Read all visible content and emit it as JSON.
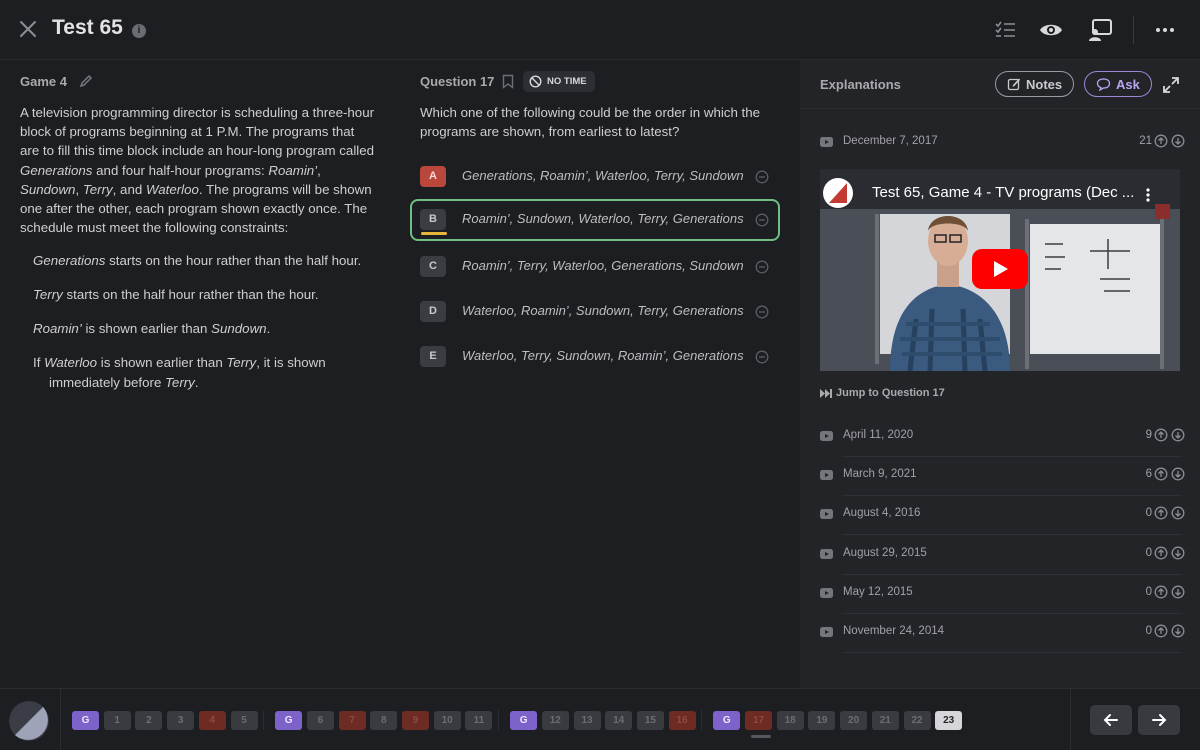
{
  "header": {
    "title": "Test 65",
    "info_glyph": "i",
    "icons": [
      "close-icon",
      "info-icon",
      "checklist-icon",
      "eye-icon",
      "present-icon",
      "more-icon"
    ]
  },
  "stimulus": {
    "game_label": "Game 4",
    "intro": [
      {
        "t": "A television programming director is scheduling a three-hour block of programs beginning at 1 P.M. The programs that are to fill this time block include an hour-long program called ",
        "i": false
      },
      {
        "t": "Generations",
        "i": true
      },
      {
        "t": " and four half-hour programs: ",
        "i": false
      },
      {
        "t": "Roamin’",
        "i": true
      },
      {
        "t": ", ",
        "i": false
      },
      {
        "t": "Sundown",
        "i": true
      },
      {
        "t": ", ",
        "i": false
      },
      {
        "t": "Terry",
        "i": true
      },
      {
        "t": ", and ",
        "i": false
      },
      {
        "t": "Waterloo",
        "i": true
      },
      {
        "t": ". The programs will be shown one after the other, each program shown exactly once. The schedule must meet the following constraints:",
        "i": false
      }
    ],
    "rules": [
      [
        {
          "t": "Generations",
          "i": true
        },
        {
          "t": " starts on the hour rather than the half hour.",
          "i": false
        }
      ],
      [
        {
          "t": "Terry",
          "i": true
        },
        {
          "t": " starts on the half hour rather than the hour.",
          "i": false
        }
      ],
      [
        {
          "t": "Roamin’",
          "i": true
        },
        {
          "t": " is shown earlier than ",
          "i": false
        },
        {
          "t": "Sundown",
          "i": true
        },
        {
          "t": ".",
          "i": false
        }
      ],
      [
        {
          "t": "If ",
          "i": false
        },
        {
          "t": "Waterloo",
          "i": true
        },
        {
          "t": " is shown earlier than ",
          "i": false
        },
        {
          "t": "Terry",
          "i": true
        },
        {
          "t": ", it is shown",
          "i": false
        }
      ]
    ],
    "rule4_cont": [
      {
        "t": "immediately before ",
        "i": false
      },
      {
        "t": "Terry",
        "i": true
      },
      {
        "t": ".",
        "i": false
      }
    ]
  },
  "question": {
    "label": "Question 17",
    "timer_badge": "NO TIME",
    "stem": "Which one of the following could be the order in which the programs are shown, from earliest to latest?",
    "answers": [
      {
        "letter": "A",
        "text": "Generations, Roamin’, Waterloo, Terry, Sundown",
        "state": "wrong"
      },
      {
        "letter": "B",
        "text": "Roamin’, Sundown, Waterloo, Terry, Generations",
        "state": "selected"
      },
      {
        "letter": "C",
        "text": "Roamin’, Terry, Waterloo, Generations, Sundown",
        "state": "normal"
      },
      {
        "letter": "D",
        "text": "Waterloo, Roamin’, Sundown, Terry, Generations",
        "state": "normal"
      },
      {
        "letter": "E",
        "text": "Waterloo, Terry, Sundown, Roamin’, Generations",
        "state": "normal"
      }
    ]
  },
  "explanations": {
    "title": "Explanations",
    "notes_label": "Notes",
    "ask_label": "Ask",
    "featured": {
      "date": "December 7, 2017",
      "votes": "21"
    },
    "video_title": "Test 65, Game 4 - TV programs (Dec ...",
    "jump_label": "Jump to Question 17",
    "videos": [
      {
        "date": "April 11, 2020",
        "votes": "9"
      },
      {
        "date": "March 9, 2021",
        "votes": "6"
      },
      {
        "date": "August 4, 2016",
        "votes": "0"
      },
      {
        "date": "August 29, 2015",
        "votes": "0"
      },
      {
        "date": "May 12, 2015",
        "votes": "0"
      },
      {
        "date": "November 24, 2014",
        "votes": "0"
      }
    ]
  },
  "navigator": {
    "groups": [
      [
        {
          "l": "G",
          "s": "g"
        },
        {
          "l": "1",
          "s": "n"
        },
        {
          "l": "2",
          "s": "n"
        },
        {
          "l": "3",
          "s": "n"
        },
        {
          "l": "4",
          "s": "r"
        },
        {
          "l": "5",
          "s": "n"
        }
      ],
      [
        {
          "l": "G",
          "s": "g"
        },
        {
          "l": "6",
          "s": "n"
        },
        {
          "l": "7",
          "s": "r"
        },
        {
          "l": "8",
          "s": "n"
        },
        {
          "l": "9",
          "s": "r"
        },
        {
          "l": "10",
          "s": "n"
        },
        {
          "l": "11",
          "s": "n"
        }
      ],
      [
        {
          "l": "G",
          "s": "g"
        },
        {
          "l": "12",
          "s": "n"
        },
        {
          "l": "13",
          "s": "n"
        },
        {
          "l": "14",
          "s": "n"
        },
        {
          "l": "15",
          "s": "n"
        },
        {
          "l": "16",
          "s": "r"
        }
      ],
      [
        {
          "l": "G",
          "s": "g"
        },
        {
          "l": "17",
          "s": "r"
        },
        {
          "l": "18",
          "s": "n"
        },
        {
          "l": "19",
          "s": "n"
        },
        {
          "l": "20",
          "s": "n"
        },
        {
          "l": "21",
          "s": "n"
        },
        {
          "l": "22",
          "s": "n"
        },
        {
          "l": "23",
          "s": "cur"
        }
      ]
    ]
  },
  "colors": {
    "background": "#1d1e21",
    "selected_border": "#6fbf83",
    "wrong": "#b9473c",
    "game_chip": "#7c62c9",
    "ask_accent": "#9a87d8"
  }
}
